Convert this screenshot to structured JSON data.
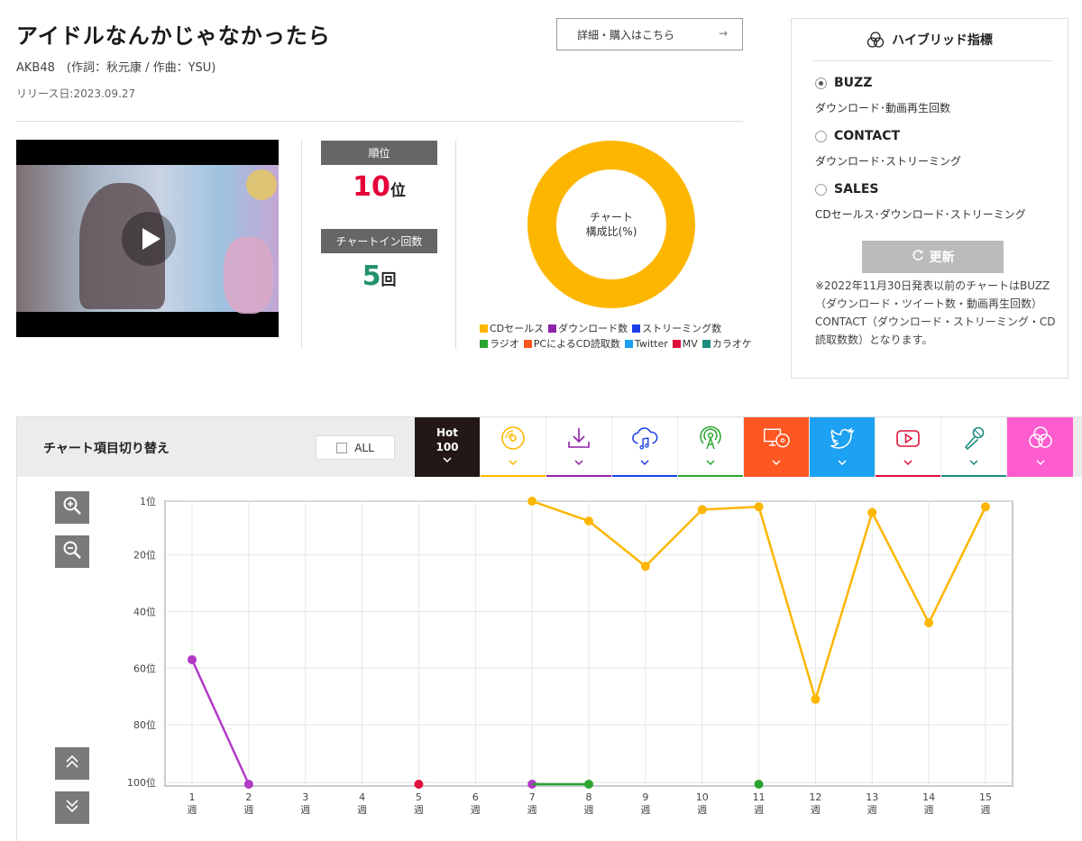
{
  "song": {
    "title": "アイドルなんかじゃなかったら",
    "meta": "AKB48　(作詞：秋元康 / 作曲：YSU)",
    "release": "リリース日:2023.09.27",
    "detail_button": "詳細・購入はこちら",
    "detail_arrow": "⇾"
  },
  "stats": {
    "rank_label": "順位",
    "rank_value": "10",
    "rank_unit": "位",
    "chartin_label": "チャートイン回数",
    "chartin_value": "5",
    "chartin_unit": "回"
  },
  "composition": {
    "center_line1": "チャート",
    "center_line2": "構成比(%)",
    "slices": [
      {
        "name": "CDセールス",
        "value": 100,
        "color": "#fdb600"
      }
    ],
    "legend_row1": [
      {
        "label": "CDセールス",
        "color": "#fdb600"
      },
      {
        "label": "ダウンロード数",
        "color": "#8e24aa"
      },
      {
        "label": "ストリーミング数",
        "color": "#1a3fe6"
      }
    ],
    "legend_row2": [
      {
        "label": "ラジオ",
        "color": "#2aa52f"
      },
      {
        "label": "PCによるCD読取数",
        "color": "#ff5722"
      },
      {
        "label": "Twitter",
        "color": "#1da1f2"
      },
      {
        "label": "MV",
        "color": "#e0103a"
      },
      {
        "label": "カラオケ",
        "color": "#1e8c7e"
      }
    ]
  },
  "hybrid": {
    "title": "ハイブリッド指標",
    "options": [
      {
        "label": "BUZZ",
        "desc": "ダウンロード･動画再生回数",
        "selected": true
      },
      {
        "label": "CONTACT",
        "desc": "ダウンロード･ストリーミング",
        "selected": false
      },
      {
        "label": "SALES",
        "desc": "CDセールス･ダウンロード･ストリーミング",
        "selected": false
      }
    ],
    "refresh_label": "更新",
    "note": "※2022年11月30日発表以前のチャートはBUZZ（ダウンロード・ツイート数・動画再生回数）CONTACT（ダウンロード・ストリーミング・CD読取数数）となります。"
  },
  "chart_switch": {
    "label": "チャート項目切り替え",
    "all_label": "ALL",
    "chevron": "⌄",
    "tabs": [
      {
        "name": "hot100",
        "line1": "Hot",
        "line2": "100",
        "icon": "hot100",
        "color": "#231815"
      },
      {
        "name": "cd-sales",
        "icon": "cd-icon",
        "color": "#fdb600"
      },
      {
        "name": "download",
        "icon": "download-icon",
        "color": "#8e24aa"
      },
      {
        "name": "streaming",
        "icon": "cloud-music-icon",
        "color": "#1a3fe6"
      },
      {
        "name": "radio",
        "icon": "radio-antenna-icon",
        "color": "#2aa52f"
      },
      {
        "name": "pc-cd-read",
        "icon": "pc-cd-icon",
        "color": "#ff5722"
      },
      {
        "name": "twitter",
        "icon": "twitter-icon",
        "color": "#1da1f2"
      },
      {
        "name": "mv",
        "icon": "video-play-icon",
        "color": "#e0103a"
      },
      {
        "name": "karaoke",
        "icon": "microphone-icon",
        "color": "#1e8c7e"
      },
      {
        "name": "hybrid",
        "icon": "hybrid-icon",
        "color": "#ff5ccf"
      }
    ]
  },
  "chart_data": {
    "type": "line",
    "x": [
      1,
      2,
      3,
      4,
      5,
      6,
      7,
      8,
      9,
      10,
      11,
      12,
      13,
      14,
      15
    ],
    "x_tick_labels": [
      "1",
      "2",
      "3",
      "4",
      "5",
      "6",
      "7",
      "8",
      "9",
      "10",
      "11",
      "12",
      "13",
      "14",
      "15"
    ],
    "x_unit": "週",
    "y_ticks": [
      1,
      20,
      40,
      60,
      80,
      100
    ],
    "y_unit": "位",
    "y_range": [
      1,
      100
    ],
    "y_inverted": true,
    "grid": true,
    "series": [
      {
        "color": "#fdb600",
        "points": [
          [
            7,
            1
          ],
          [
            8,
            8
          ],
          [
            9,
            24
          ],
          [
            10,
            4
          ],
          [
            11,
            3
          ],
          [
            12,
            71
          ],
          [
            13,
            5
          ],
          [
            14,
            44
          ],
          [
            15,
            3
          ]
        ]
      },
      {
        "color": "#b23ac7",
        "points": [
          [
            1,
            57
          ],
          [
            2,
            101
          ]
        ]
      },
      {
        "color": "#b23ac7",
        "points": [
          [
            7,
            101
          ]
        ]
      },
      {
        "color": "#e0103a",
        "points": [
          [
            5,
            101
          ]
        ]
      },
      {
        "color": "#2aa52f",
        "points": [
          [
            8,
            101
          ],
          [
            11,
            101
          ]
        ],
        "segments": [
          [
            7,
            8
          ]
        ]
      }
    ]
  },
  "controls": {
    "zoom_in_icon": "zoom-in-icon",
    "zoom_out_icon": "zoom-out-icon",
    "scroll_up_icon": "double-chevron-up-icon",
    "scroll_down_icon": "double-chevron-down-icon"
  }
}
